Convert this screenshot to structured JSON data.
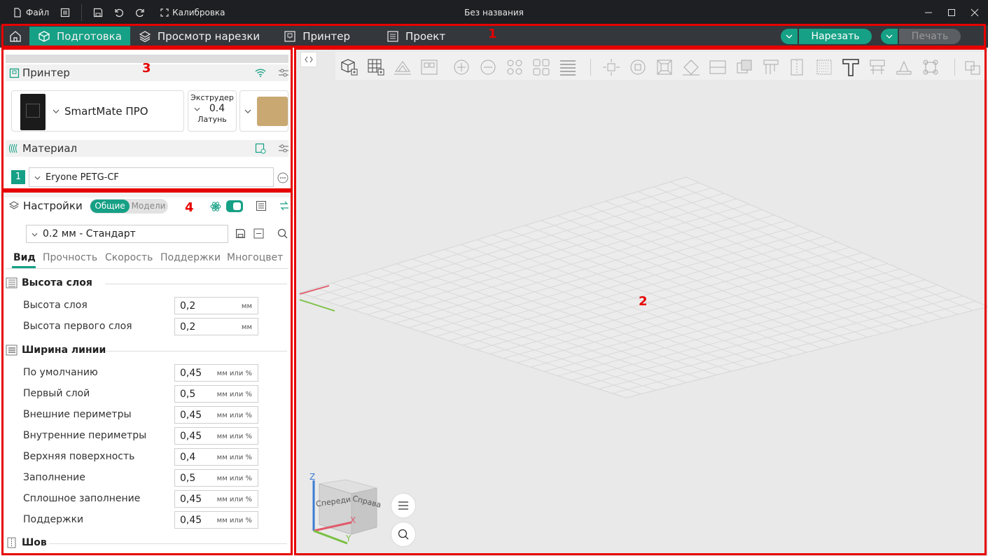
{
  "titlebar": {
    "file_label": "Файл",
    "calibration_label": "Калибровка",
    "title": "Без названия"
  },
  "nav": {
    "tabs": [
      {
        "label": "Подготовка",
        "active": true
      },
      {
        "label": "Просмотр нарезки"
      },
      {
        "label": "Принтер"
      },
      {
        "label": "Проект"
      }
    ],
    "slice_label": "Нарезать",
    "print_label": "Печать"
  },
  "annotations": {
    "a1": "1",
    "a2": "2",
    "a3": "3",
    "a4": "4"
  },
  "printer": {
    "header": "Принтер",
    "model": "SmartMate ПРО",
    "extruder_label": "Экструдер",
    "extruder_size": "0.4",
    "nozzle_material": "Латунь"
  },
  "material": {
    "header": "Материал",
    "slot": "1",
    "filament": "Eryone PETG-CF"
  },
  "settings": {
    "header": "Настройки",
    "toggle_general": "Общие",
    "toggle_models": "Модели",
    "profile": "0.2 мм - Стандарт",
    "tabs": [
      "Вид",
      "Прочность",
      "Скорость",
      "Поддержки",
      "Многоцвет"
    ],
    "groups": {
      "layer_height": "Высота слоя",
      "line_width": "Ширина линии",
      "seam": "Шов"
    },
    "layer_rows": [
      {
        "label": "Высота слоя",
        "value": "0,2",
        "unit": "мм"
      },
      {
        "label": "Высота первого слоя",
        "value": "0,2",
        "unit": "мм"
      }
    ],
    "width_rows": [
      {
        "label": "По умолчанию",
        "value": "0,45",
        "unit": "мм или %"
      },
      {
        "label": "Первый слой",
        "value": "0,5",
        "unit": "мм или %"
      },
      {
        "label": "Внешние периметры",
        "value": "0,45",
        "unit": "мм или %"
      },
      {
        "label": "Внутренние периметры",
        "value": "0,45",
        "unit": "мм или %"
      },
      {
        "label": "Верхняя поверхность",
        "value": "0,4",
        "unit": "мм или %"
      },
      {
        "label": "Заполнение",
        "value": "0,5",
        "unit": "мм или %"
      },
      {
        "label": "Сплошное заполнение",
        "value": "0,45",
        "unit": "мм или %"
      },
      {
        "label": "Поддержки",
        "value": "0,45",
        "unit": "мм или %"
      }
    ]
  },
  "viewcube": {
    "front": "Спереди",
    "right": "Справа",
    "axis_z": "Z",
    "axis_x": "X",
    "axis_y": "Y"
  },
  "colors": {
    "accent": "#16a085",
    "annotation": "#e60000",
    "nav_bg": "#34373c",
    "title_bg": "#1e1f22"
  }
}
